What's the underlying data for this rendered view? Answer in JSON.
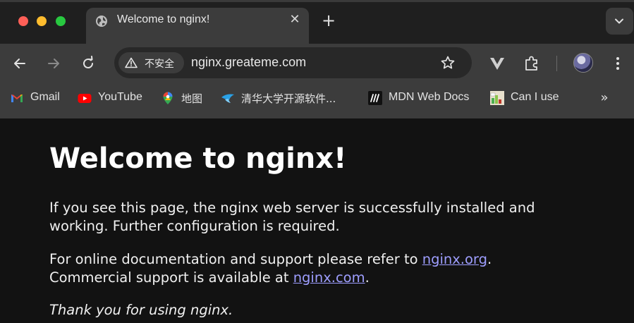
{
  "browser": {
    "tab": {
      "title": "Welcome to nginx!",
      "close_glyph": "✕"
    },
    "new_tab_glyph": "+",
    "address": {
      "security_label": "不安全",
      "url": "nginx.greateme.com"
    },
    "bookmarks": [
      {
        "label": "Gmail",
        "icon": "gmail-icon"
      },
      {
        "label": "YouTube",
        "icon": "youtube-icon"
      },
      {
        "label": "地图",
        "icon": "maps-icon"
      },
      {
        "label": "清华大学开源软件...",
        "icon": "tuna-icon"
      },
      {
        "label": "MDN Web Docs",
        "icon": "mdn-icon"
      },
      {
        "label": "Can I use",
        "icon": "caniuse-icon"
      }
    ],
    "more_bookmarks_glyph": "»"
  },
  "page": {
    "heading": "Welcome to nginx!",
    "para1_line1": "If you see this page, the nginx web server is successfully installed and",
    "para1_line2": "working. Further configuration is required.",
    "para2_line1_prefix": "For online documentation and support please refer to ",
    "para2_link1": "nginx.org",
    "para2_line1_suffix": ".",
    "para2_line2_prefix": "Commercial support is available at ",
    "para2_link2": "nginx.com",
    "para2_line2_suffix": ".",
    "para3": "Thank you for using nginx."
  },
  "colors": {
    "page_background": "#121212",
    "toolbar": "#3c3c3c",
    "link": "#9e9eff"
  }
}
